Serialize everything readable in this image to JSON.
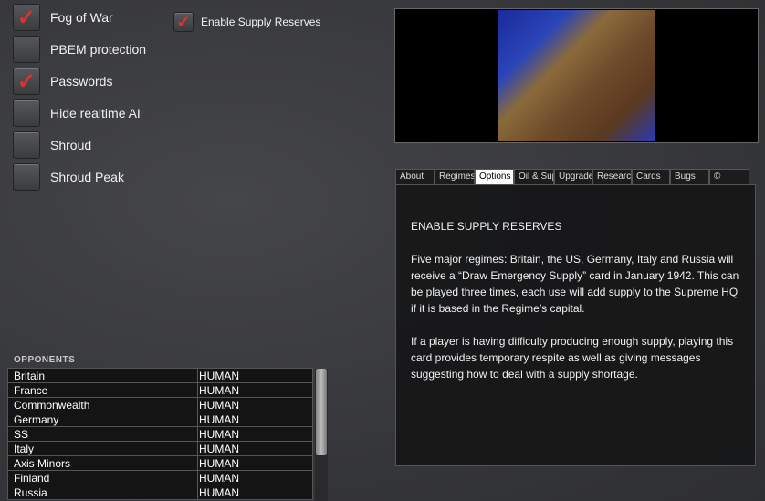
{
  "options": [
    {
      "label": "Fog of War",
      "checked": true
    },
    {
      "label": "PBEM protection",
      "checked": false
    },
    {
      "label": "Passwords",
      "checked": true
    },
    {
      "label": "Hide realtime AI",
      "checked": false
    },
    {
      "label": "Shroud",
      "checked": false
    },
    {
      "label": "Shroud Peak",
      "checked": false
    }
  ],
  "supply_option": {
    "label": "Enable Supply Reserves",
    "checked": true
  },
  "check_glyph": "✓",
  "tabs": [
    "About",
    "Regimes",
    "Options",
    "Oil & Sup",
    "Upgrades",
    "Research",
    "Cards",
    "Bugs",
    "©"
  ],
  "active_tab": "Options",
  "panel": {
    "title": "ENABLE SUPPLY RESERVES",
    "p1": "Five major regimes: Britain, the US, Germany, Italy and Russia will receive a “Draw Emergency Supply” card in January 1942. This can be played three times, each use will add supply to the Supreme HQ if it is based in the Regime’s capital.",
    "p2": "If a player is having difficulty producing enough supply, playing this card provides temporary respite as well as giving messages suggesting how to deal with a supply shortage."
  },
  "opponents": {
    "title": "OPPONENTS",
    "rows": [
      {
        "name": "Britain",
        "type": "HUMAN"
      },
      {
        "name": "France",
        "type": "HUMAN"
      },
      {
        "name": "Commonwealth",
        "type": "HUMAN"
      },
      {
        "name": "Germany",
        "type": "HUMAN"
      },
      {
        "name": "SS",
        "type": "HUMAN"
      },
      {
        "name": "Italy",
        "type": "HUMAN"
      },
      {
        "name": "Axis Minors",
        "type": "HUMAN"
      },
      {
        "name": "Finland",
        "type": "HUMAN"
      },
      {
        "name": "Russia",
        "type": "HUMAN"
      }
    ]
  }
}
